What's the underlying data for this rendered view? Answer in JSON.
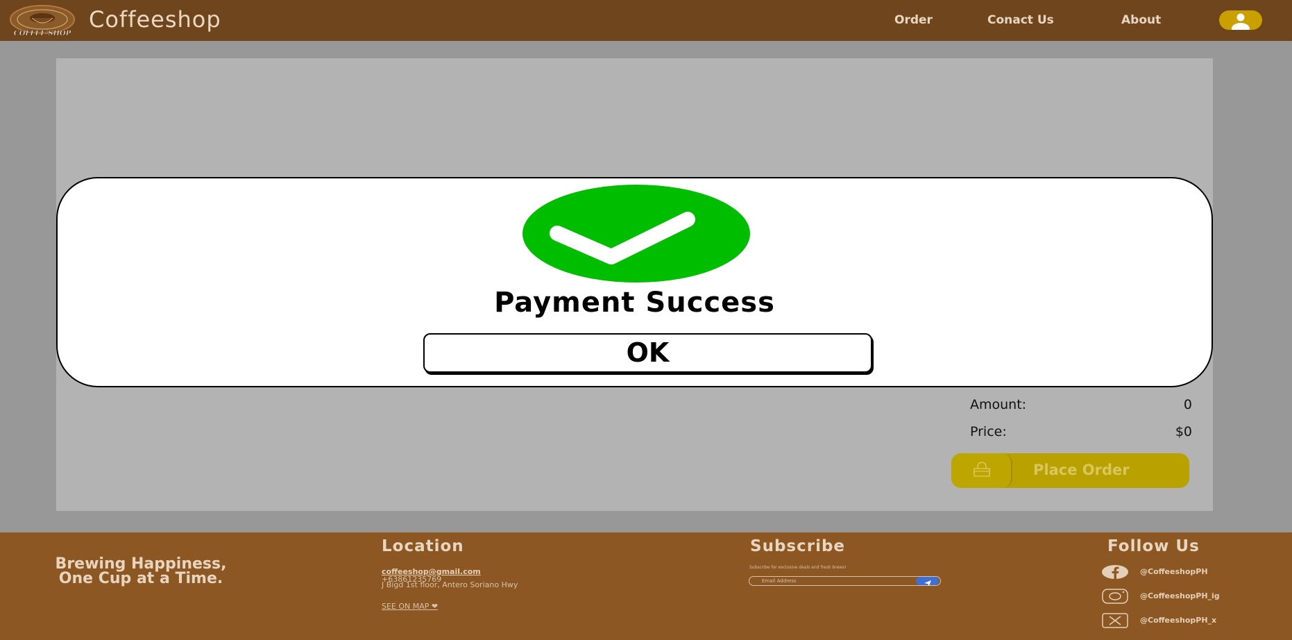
{
  "header": {
    "logo_text": "COFFEE SHOP",
    "brand": "Coffeeshop",
    "nav": [
      "Order",
      "Conact Us",
      "About"
    ],
    "avatar_icon": "user-avatar-icon"
  },
  "order_summary": {
    "amount_label": "Amount:",
    "amount_value": "0",
    "price_label": "Price:",
    "price_value": "$0",
    "place_order_label": "Place Order",
    "place_order_icon": "shopping-bag-icon"
  },
  "modal": {
    "icon": "check-circle-icon",
    "title": "Payment Success",
    "ok_label": "OK"
  },
  "footer": {
    "tagline": "Brewing Happiness, One Cup at a Time.",
    "location": {
      "heading": "Location",
      "email": "coffeeshop@gmail.com",
      "phone": "+63861235769",
      "address": "J Bigd 1st floor, Antero Soriano Hwy",
      "map_link": "SEE ON MAP ❤"
    },
    "subscribe": {
      "heading": "Subscribe",
      "description": "Subscribe for exclusive deals and fresh brews!",
      "placeholder": "Email Address",
      "send_icon": "send-icon"
    },
    "follow": {
      "heading": "Follow Us",
      "items": [
        {
          "icon": "facebook-icon",
          "handle": "@CoffeeshopPH"
        },
        {
          "icon": "instagram-icon",
          "handle": "@CoffeeshopPH_ig"
        },
        {
          "icon": "x-icon",
          "handle": "@CoffeeshopPH_x"
        }
      ]
    }
  },
  "colors": {
    "header": "#6f451e",
    "footer": "#8c5722",
    "backdrop": "#989898",
    "success_green": "#00bd00",
    "place_order": "#b9a200"
  }
}
